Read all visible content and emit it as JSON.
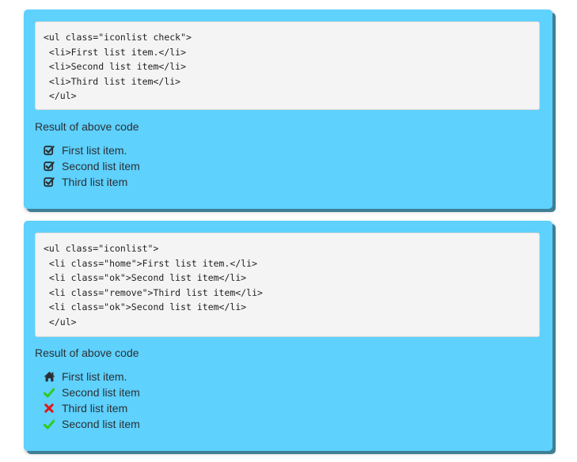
{
  "panel1": {
    "code_lines": [
      "<ul class=\"iconlist check\">",
      " <li>First list item.</li>",
      " <li>Second list item</li>",
      " <li>Third list item</li>",
      " </ul>"
    ],
    "caption": "Result of above code",
    "items": [
      {
        "label": "First list item.",
        "icon": "check-square-icon"
      },
      {
        "label": "Second list item",
        "icon": "check-square-icon"
      },
      {
        "label": "Third list item",
        "icon": "check-square-icon"
      }
    ]
  },
  "panel2": {
    "code_lines": [
      "<ul class=\"iconlist\">",
      " <li class=\"home\">First list item.</li>",
      " <li class=\"ok\">Second list item</li>",
      " <li class=\"remove\">Third list item</li>",
      " <li class=\"ok\">Second list item</li>",
      " </ul>"
    ],
    "caption": "Result of above code",
    "items": [
      {
        "label": "First list item.",
        "icon": "home-icon"
      },
      {
        "label": "Second list item",
        "icon": "check-icon"
      },
      {
        "label": "Third list item",
        "icon": "remove-icon"
      },
      {
        "label": "Second list item",
        "icon": "check-icon"
      }
    ]
  },
  "colors": {
    "panel_bg": "#5ed1fd",
    "panel_shadow": "#3f7f96",
    "code_bg": "#f4f4f4",
    "check_green": "#2ecc1f",
    "remove_red": "#e01818",
    "icon_dark": "#2b3034"
  }
}
